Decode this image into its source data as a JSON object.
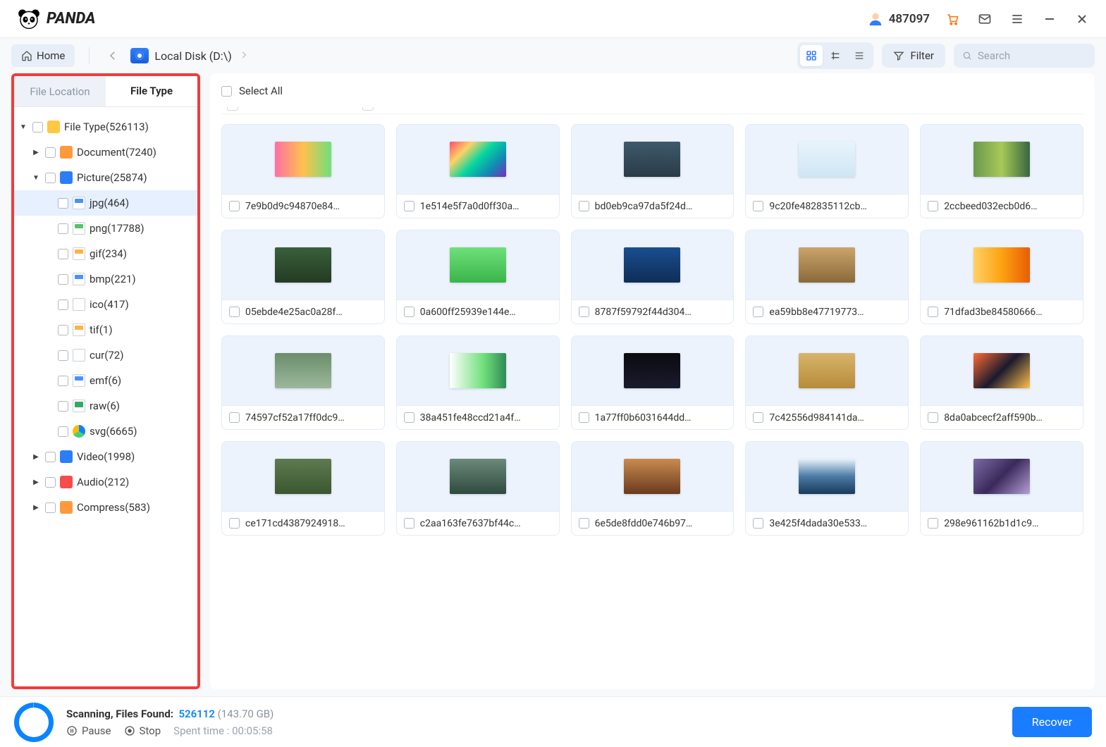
{
  "titlebar": {
    "brand": "PANDA",
    "user_id": "487097"
  },
  "toolbar": {
    "home_label": "Home",
    "disk_label": "Local Disk (D:\\)",
    "filter_label": "Filter",
    "search_placeholder": "Search"
  },
  "sidebar": {
    "tabs": {
      "location": "File Location",
      "type": "File Type"
    },
    "root": "File Type(526113)",
    "document": "Document(7240)",
    "picture": "Picture(25874)",
    "picture_children": [
      {
        "label": "jpg(464)",
        "cls": "jpg",
        "selected": true
      },
      {
        "label": "png(17788)",
        "cls": "png"
      },
      {
        "label": "gif(234)",
        "cls": "gif"
      },
      {
        "label": "bmp(221)",
        "cls": "bmp"
      },
      {
        "label": "ico(417)",
        "cls": "ico"
      },
      {
        "label": "tif(1)",
        "cls": "tif"
      },
      {
        "label": "cur(72)",
        "cls": "cur"
      },
      {
        "label": "emf(6)",
        "cls": "emf"
      },
      {
        "label": "raw(6)",
        "cls": "raw"
      },
      {
        "label": "svg(6665)",
        "cls": "svg"
      }
    ],
    "video": "Video(1998)",
    "audio": "Audio(212)",
    "compress": "Compress(583)"
  },
  "content": {
    "select_all": "Select All",
    "files": [
      "7e9b0d9c94870e84…",
      "1e514e5f7a0d0ff30a…",
      "bd0eb9ca97da5f24d…",
      "9c20fe482835112cb…",
      "2ccbeed032ecb0d6…",
      "05ebde4e25ac0a28f…",
      "0a600ff25939e144e…",
      "8787f59792f44d304…",
      "ea59bb8e47719773…",
      "71dfad3be84580666…",
      "74597cf52a17ff0dc9…",
      "38a451fe48ccd21a4f…",
      "1a77ff0b6031644dd…",
      "7c42556d984141da…",
      "8da0abcecf2aff590b…",
      "ce171cd4387924918…",
      "c2aa163fe7637bf44c…",
      "6e5de8fdd0e746b97…",
      "3e425f4dada30e533…",
      "298e961162b1d1c9…"
    ],
    "palettes": [
      "p1",
      "p2",
      "p3",
      "p4",
      "p5",
      "p6",
      "p7",
      "p8",
      "p9",
      "p10",
      "p11",
      "p12",
      "p13",
      "p14",
      "p15",
      "p16",
      "p17",
      "p18",
      "p19",
      "p20"
    ]
  },
  "status": {
    "percent": "100",
    "scanning_label": "Scanning, Files Found:",
    "count": "526112",
    "size": "(143.70 GB)",
    "pause": "Pause",
    "stop": "Stop",
    "spent_label": "Spent time : ",
    "spent_value": "00:05:58",
    "recover": "Recover"
  }
}
